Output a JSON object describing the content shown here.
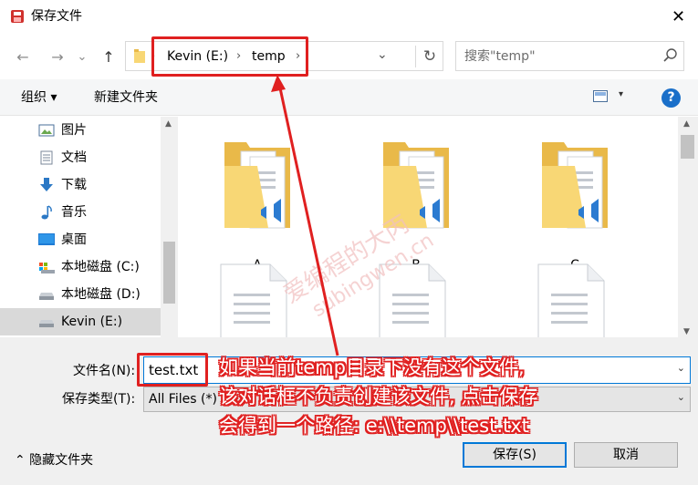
{
  "window": {
    "title": "保存文件",
    "close_glyph": "✕"
  },
  "nav": {
    "back_glyph": "←",
    "forward_glyph": "→",
    "recent_glyph": "⌄",
    "up_glyph": "↑",
    "breadcrumbs": [
      "Kevin (E:)",
      "temp"
    ],
    "separator": "›",
    "dropdown_glyph": "⌄",
    "refresh_glyph": "↻"
  },
  "search": {
    "placeholder": "搜索\"temp\""
  },
  "toolbar": {
    "organize_label": "组织 ▾",
    "new_folder_label": "新建文件夹",
    "help_label": "?",
    "view_drop": "▾"
  },
  "sidebar": {
    "items": [
      {
        "label": "图片",
        "icon": "pictures-icon"
      },
      {
        "label": "文档",
        "icon": "documents-icon"
      },
      {
        "label": "下载",
        "icon": "downloads-icon"
      },
      {
        "label": "音乐",
        "icon": "music-icon"
      },
      {
        "label": "桌面",
        "icon": "desktop-icon"
      },
      {
        "label": "本地磁盘 (C:)",
        "icon": "drive-c-icon"
      },
      {
        "label": "本地磁盘 (D:)",
        "icon": "drive-d-icon"
      },
      {
        "label": "Kevin (E:)",
        "icon": "drive-e-icon"
      }
    ]
  },
  "content": {
    "folders": [
      {
        "label": "A"
      },
      {
        "label": "B"
      },
      {
        "label": "C"
      }
    ]
  },
  "form": {
    "filename_label": "文件名(N):",
    "filename_value": "test.txt",
    "filetype_label": "保存类型(T):",
    "filetype_value": "All Files  (*)",
    "dropdown_glyph": "⌄"
  },
  "footer": {
    "hide_folders_label": "⌃  隐藏文件夹",
    "save_label": "保存(S)",
    "cancel_label": "取消"
  },
  "annotation": {
    "lines": [
      "如果当前temp目录下没有这个文件,",
      "该对话框不负责创建该文件, 点击保存",
      "会得到一个路径: e:\\\\temp\\\\test.txt"
    ],
    "watermark": "爱编程的大丙 subingwen.cn"
  },
  "colors": {
    "accent": "#0078d7",
    "annotation_red": "#e02020",
    "folder_yellow": "#f8d775"
  }
}
